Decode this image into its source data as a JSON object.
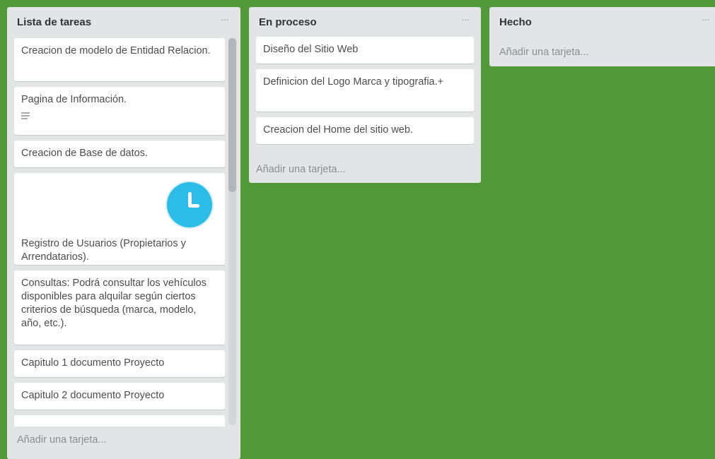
{
  "lists": [
    {
      "title": "Lista de tareas",
      "menu": "···",
      "cards": [
        {
          "text": "Creacion de modelo de Entidad Relacion."
        },
        {
          "text": "Pagina de Información.",
          "has_description": true,
          "icon": "description-icon"
        },
        {
          "text": "Creacion de Base de datos."
        },
        {
          "text": "Registro de Usuarios (Propietarios y Arrendatarios).",
          "cover": "clock-icon",
          "cover_color": "#2bbce8"
        },
        {
          "text": "Consultas: Podrá consultar los vehículos disponibles para alquilar según ciertos criterios de búsqueda (marca, modelo, año, etc.)."
        },
        {
          "text": "Capitulo 1 documento Proyecto"
        },
        {
          "text": "Capitulo 2 documento Proyecto"
        }
      ],
      "add_card": "Añadir una tarjeta..."
    },
    {
      "title": "En proceso",
      "menu": "···",
      "cards": [
        {
          "text": "Diseño del Sitio Web"
        },
        {
          "text": "Definicion del Logo Marca y tipografia.+"
        },
        {
          "text": "Creacion del Home del sitio web."
        }
      ],
      "add_card": "Añadir una tarjeta..."
    },
    {
      "title": "Hecho",
      "menu": "···",
      "cards": [],
      "add_card": "Añadir una tarjeta..."
    }
  ],
  "colors": {
    "board_background": "#519839",
    "list_background": "#e2e4e6",
    "card_background": "#ffffff"
  }
}
